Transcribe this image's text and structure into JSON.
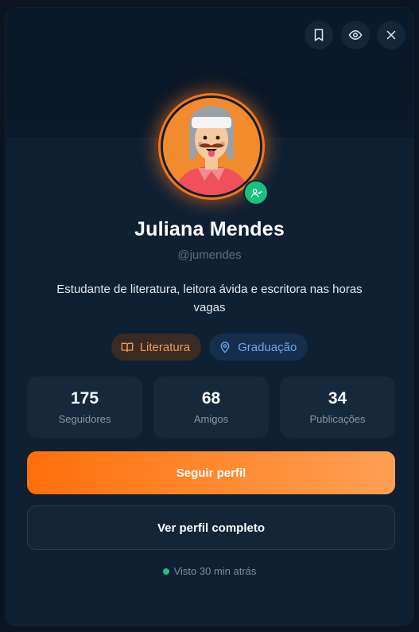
{
  "profile": {
    "name": "Juliana Mendes",
    "handle": "@jumendes",
    "bio": "Estudante de literatura, leitora ávida e escritora nas horas vagas"
  },
  "header_actions": [
    {
      "icon": "bookmark-icon"
    },
    {
      "icon": "eye-icon"
    },
    {
      "icon": "close-icon"
    }
  ],
  "avatar": {
    "status_icon": "user-check-icon"
  },
  "tags": [
    {
      "label": "Literatura",
      "icon": "book-open-icon",
      "color": "#f29b57"
    },
    {
      "label": "Graduação",
      "icon": "map-pin-icon",
      "color": "#6fa8f0"
    }
  ],
  "stats": [
    {
      "value": "175",
      "label": "Seguidores"
    },
    {
      "value": "68",
      "label": "Amigos"
    },
    {
      "value": "34",
      "label": "Publicações"
    }
  ],
  "actions": {
    "follow_label": "Seguir perfil",
    "view_label": "Ver perfil completo"
  },
  "last_seen": "Visto 30 min atrás",
  "colors": {
    "accent": "#ff7a1a",
    "online": "#1ec27e",
    "card_bg": "#0f2033"
  }
}
